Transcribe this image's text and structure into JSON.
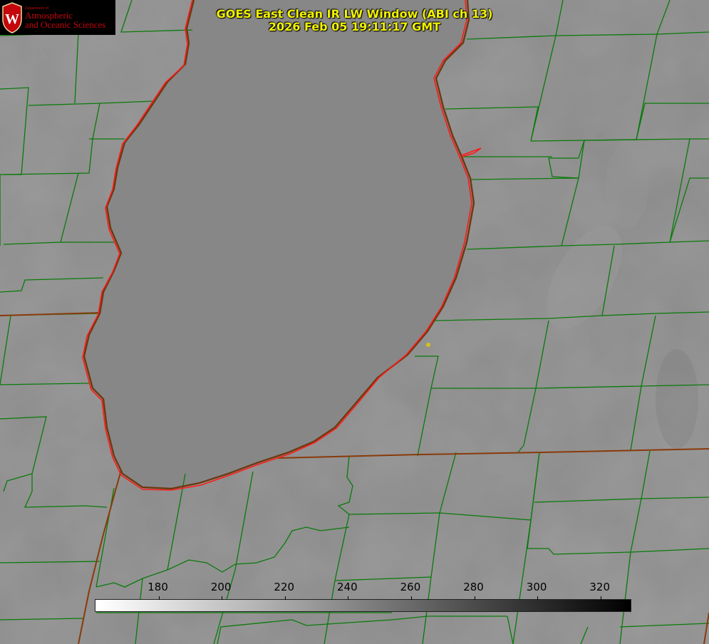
{
  "title": {
    "line1": "GOES East Clean IR LW Window (ABI ch 13)",
    "line2": "2026 Feb 05 19:11:17 GMT"
  },
  "logo": {
    "dept": "Department of",
    "line1": "Atmospheric",
    "line2": "and Oceanic Sciences",
    "crest_letter": "W"
  },
  "colors": {
    "title_text": "#f2f200",
    "county_lines": "#0a7a0a",
    "state_lines": "#8a3a0a",
    "coastline": "#ff1a1a",
    "lake": "#888888",
    "land": "#8c8c8c",
    "logo_red": "#c5050c",
    "marker": "#d4c21a"
  },
  "colorbar": {
    "min": 160,
    "max": 330,
    "ticks": [
      "180",
      "200",
      "220",
      "240",
      "260",
      "280",
      "300",
      "320"
    ],
    "tick_values": [
      180,
      200,
      220,
      240,
      260,
      280,
      300,
      320
    ]
  }
}
